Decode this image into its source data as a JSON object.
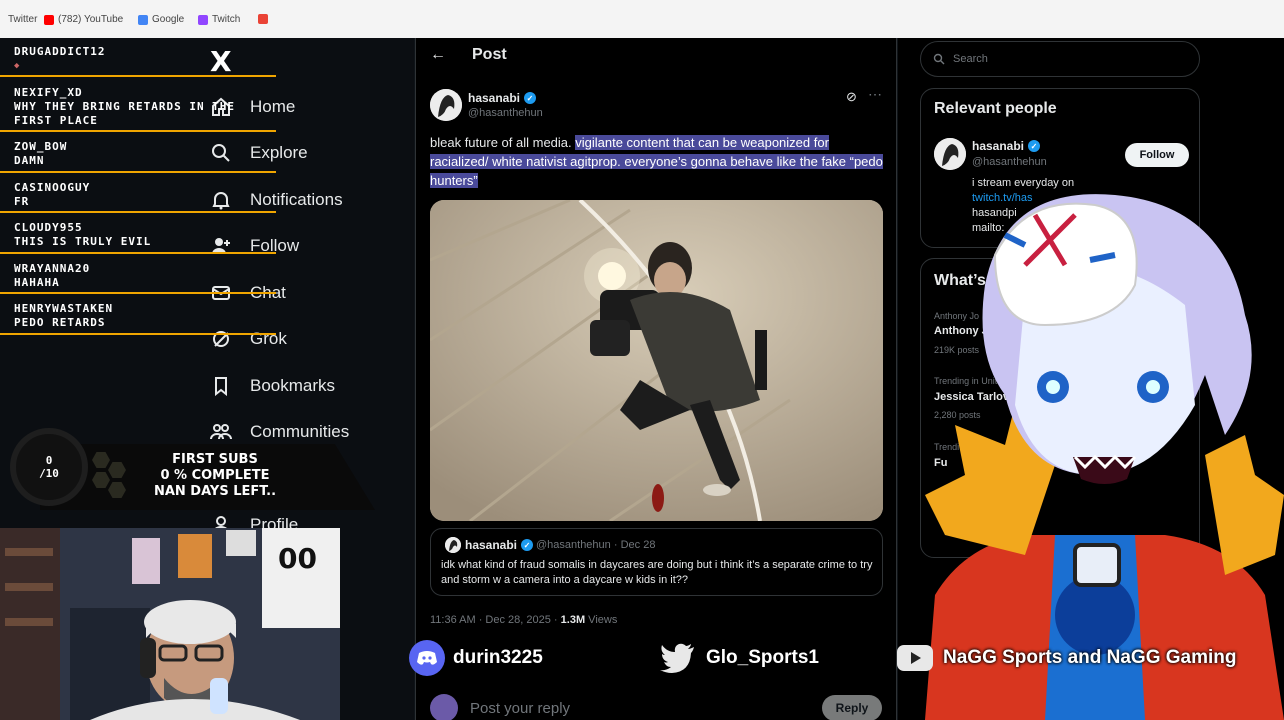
{
  "browser": {
    "bookmarks": [
      {
        "label": "Twitter",
        "color": "#1d9bf0"
      },
      {
        "label": "(782) YouTube",
        "color": "#ff0000"
      },
      {
        "label": "Google",
        "color": "#4285f4"
      },
      {
        "label": "Twitch",
        "color": "#9146ff"
      }
    ]
  },
  "chat": [
    {
      "user": "DRUGADDICT12",
      "message": ""
    },
    {
      "user": "NEXIFY_XD",
      "message": "WHY THEY BRING RETARDS IN THE FIRST PLACE"
    },
    {
      "user": "ZOW_BOW",
      "message": "DAMN"
    },
    {
      "user": "CASINOOGUY",
      "message": "FR"
    },
    {
      "user": "CLOUDY955",
      "message": "THIS IS TRULY EVIL"
    },
    {
      "user": "WRAYANNA20",
      "message": "HAHAHA"
    },
    {
      "user": "HENRYWASTAKEN",
      "message": "PEDO RETARDS"
    }
  ],
  "nav": {
    "logo": "X",
    "items": [
      {
        "label": "Home",
        "icon": "home-icon"
      },
      {
        "label": "Explore",
        "icon": "search-icon"
      },
      {
        "label": "Notifications",
        "icon": "bell-icon"
      },
      {
        "label": "Follow",
        "icon": "person-plus-icon"
      },
      {
        "label": "Chat",
        "icon": "mail-icon"
      },
      {
        "label": "Grok",
        "icon": "grok-icon"
      },
      {
        "label": "Bookmarks",
        "icon": "bookmark-icon"
      },
      {
        "label": "Communities",
        "icon": "communities-icon"
      },
      {
        "label": "Profile",
        "icon": "profile-icon"
      }
    ]
  },
  "goal": {
    "count": "0",
    "target": "/10",
    "line1": "FIRST SUBS",
    "line2": "0 % COMPLETE",
    "line3": "NAN DAYS LEFT.."
  },
  "post": {
    "header": "Post",
    "author": "hasanabi",
    "handle": "@hasanthehun",
    "text_plain": "bleak future of all media. ",
    "text_highlighted": "vigilante content that can be weaponized for racialized/ white nativist agitprop. everyone’s gonna behave like the fake “pedo hunters”",
    "quote": {
      "author": "hasanabi",
      "handle": "@hasanthehun",
      "date": "· Dec 28",
      "text": "idk what kind of fraud somalis in daycares are doing but i think it’s a separate crime to try and storm w a camera into a daycare w kids in it??"
    },
    "time": "11:36 AM · Dec 28, 2025 · ",
    "views": "1.3M",
    "views_label": " Views",
    "reply_placeholder": "Post your reply",
    "reply_button": "Reply"
  },
  "right": {
    "search_placeholder": "Search",
    "relevant_title": "Relevant people",
    "person": {
      "name": "hasanabi",
      "handle": "@hasanthehun",
      "bio1": "i stream everyday on",
      "bio2": "twitch.tv/has",
      "bio3": "hasandpi",
      "bio4": "mailto:",
      "follow": "Follow"
    },
    "whats_title": "What’s h",
    "trends": [
      {
        "sub": "Anthony Jo",
        "name": "Anthony J",
        "posts": "219K posts"
      },
      {
        "sub": "Trending in United S",
        "name": "Jessica Tarlov",
        "posts": "2,280 posts"
      },
      {
        "sub": "Trendi",
        "name": "Fu",
        "posts": ""
      }
    ]
  },
  "social": {
    "discord": "durin3225",
    "twitter": "Glo_Sports1",
    "youtube": "NaGG Sports and NaGG Gaming"
  }
}
